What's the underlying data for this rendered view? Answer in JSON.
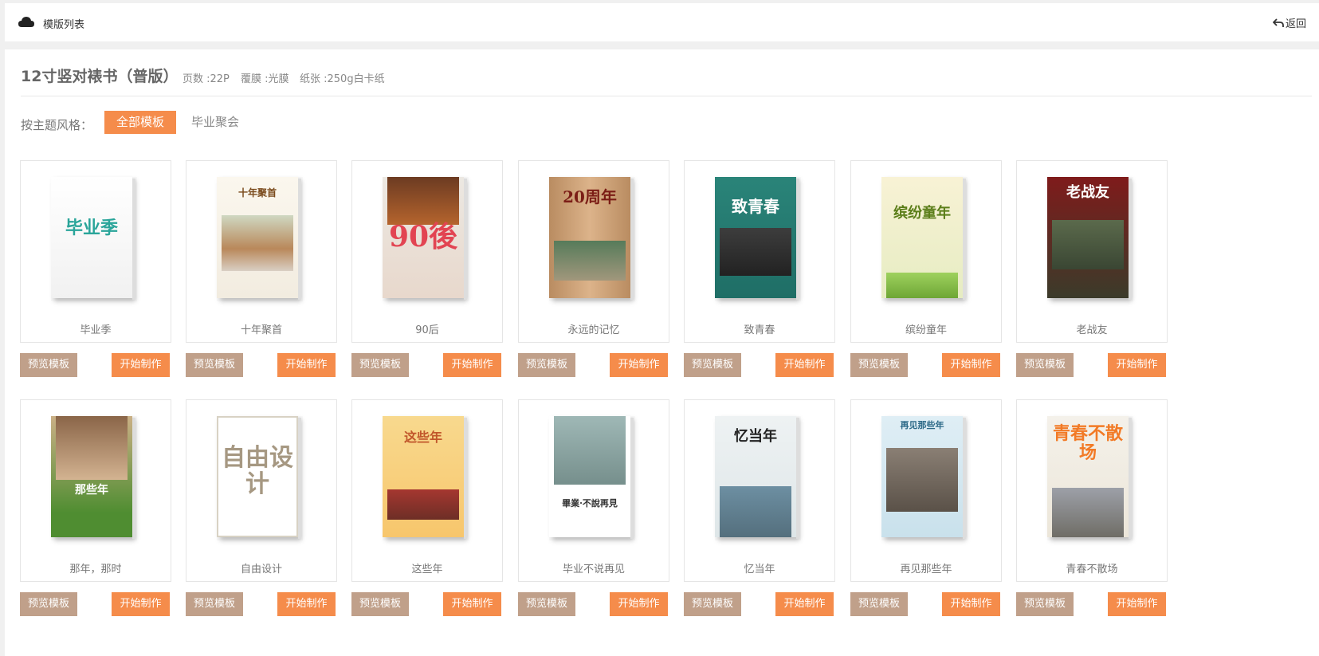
{
  "header": {
    "title": "模版列表",
    "back_label": "返回"
  },
  "product": {
    "title": "12寸竖对裱书（普版）",
    "pages": "页数 :22P",
    "film": "覆膜 :光膜",
    "paper": "纸张 :250g白卡纸"
  },
  "filter": {
    "label": "按主题风格：",
    "options": [
      "全部模板",
      "毕业聚会"
    ]
  },
  "buttons": {
    "preview": "预览模板",
    "start": "开始制作"
  },
  "templates": [
    {
      "name": "毕业季",
      "cover_text": "毕业季"
    },
    {
      "name": "十年聚首",
      "cover_text": "十年聚首"
    },
    {
      "name": "90后",
      "cover_text": "90後"
    },
    {
      "name": "永远的记忆",
      "cover_text": "20周年"
    },
    {
      "name": "致青春",
      "cover_text": "致青春"
    },
    {
      "name": "缤纷童年",
      "cover_text": "缤纷童年"
    },
    {
      "name": "老战友",
      "cover_text": "老战友"
    },
    {
      "name": "那年，那时",
      "cover_text": "那些年"
    },
    {
      "name": "自由设计",
      "cover_text": "自由设计"
    },
    {
      "name": "这些年",
      "cover_text": "这些年"
    },
    {
      "name": "毕业不说再见",
      "cover_text": "畢業·不說再見"
    },
    {
      "name": "忆当年",
      "cover_text": "忆当年"
    },
    {
      "name": "再见那些年",
      "cover_text": "再见那些年"
    },
    {
      "name": "青春不散场",
      "cover_text": "青春不散场"
    }
  ]
}
